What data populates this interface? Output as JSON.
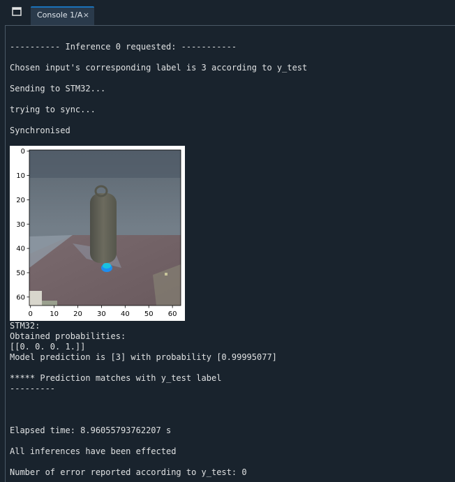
{
  "tab": {
    "label": "Console 1/A",
    "close": "×"
  },
  "console": {
    "lines": [
      "---------- Inference 0 requested: -----------",
      "Chosen input's corresponding label is 3 according to y_test",
      "Sending to STM32...",
      "trying to sync...",
      "Synchronised"
    ],
    "lines_after": [
      "STM32:",
      "Obtained probabilities:",
      "[[0. 0. 0. 1.]]",
      "Model prediction is [3] with probability [0.99995077]",
      "***** Prediction matches with y_test label",
      "---------",
      "Elapsed time: 8.96055793762207 s",
      "All inferences have been effected",
      "Number of error reported according to y_test: 0"
    ]
  },
  "plot": {
    "x_ticks": [
      "0",
      "10",
      "20",
      "30",
      "40",
      "50",
      "60"
    ],
    "y_ticks": [
      "0",
      "10",
      "20",
      "30",
      "40",
      "50",
      "60"
    ]
  },
  "colors": {
    "background": "#19232d",
    "tab_active": "#2a3a4b",
    "tab_accent": "#1a72bb",
    "text": "#dfe1e2"
  }
}
